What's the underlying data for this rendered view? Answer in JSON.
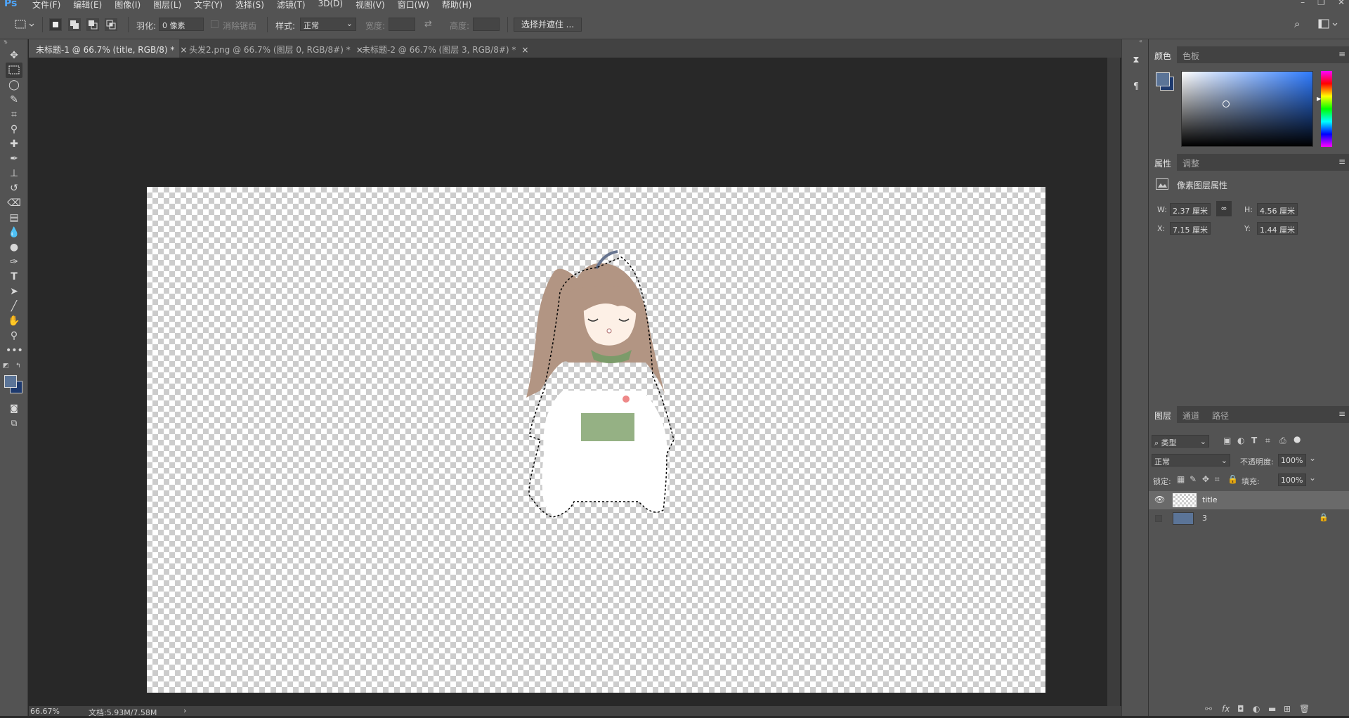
{
  "app": {
    "logo": "Ps"
  },
  "menu": [
    "文件(F)",
    "编辑(E)",
    "图像(I)",
    "图层(L)",
    "文字(Y)",
    "选择(S)",
    "滤镜(T)",
    "3D(D)",
    "视图(V)",
    "窗口(W)",
    "帮助(H)"
  ],
  "options": {
    "feather_label": "羽化:",
    "feather_value": "0 像素",
    "antialias_label": "消除锯齿",
    "style_label": "样式:",
    "style_value": "正常",
    "width_label": "宽度:",
    "height_label": "高度:",
    "mask_button": "选择并遮住 ..."
  },
  "tabs": [
    {
      "label": "未标题-1 @ 66.7% (title, RGB/8) *",
      "close": "×"
    },
    {
      "label": "头发2.png @ 66.7% (图层 0, RGB/8#) *",
      "close": "×"
    },
    {
      "label": "未标题-2 @ 66.7% (图层 3, RGB/8#) *",
      "close": "×"
    }
  ],
  "status": {
    "zoom": "66.67%",
    "doc": "文档:5.93M/7.58M",
    "arrow": "›"
  },
  "color_panel": {
    "tab1": "颜色",
    "tab2": "色板",
    "fg": "#5b7497",
    "bg": "#1e3a6e"
  },
  "properties_panel": {
    "tab1": "属性",
    "tab2": "调整",
    "title": "像素图层属性",
    "w_label": "W:",
    "w_value": "2.37 厘米",
    "h_label": "H:",
    "h_value": "4.56 厘米",
    "x_label": "X:",
    "x_value": "7.15 厘米",
    "y_label": "Y:",
    "y_value": "1.44 厘米"
  },
  "layers_panel": {
    "tab1": "图层",
    "tab2": "通道",
    "tab3": "路径",
    "filter_value": "类型",
    "blend_mode": "正常",
    "opacity_label": "不透明度:",
    "opacity_value": "100%",
    "lock_label": "锁定:",
    "fill_label": "填充:",
    "fill_value": "100%",
    "layers": [
      {
        "name": "title",
        "selected": true,
        "visible": true
      },
      {
        "name": "3",
        "selected": false,
        "visible": false,
        "locked": true,
        "color": "#5b7497"
      }
    ]
  }
}
